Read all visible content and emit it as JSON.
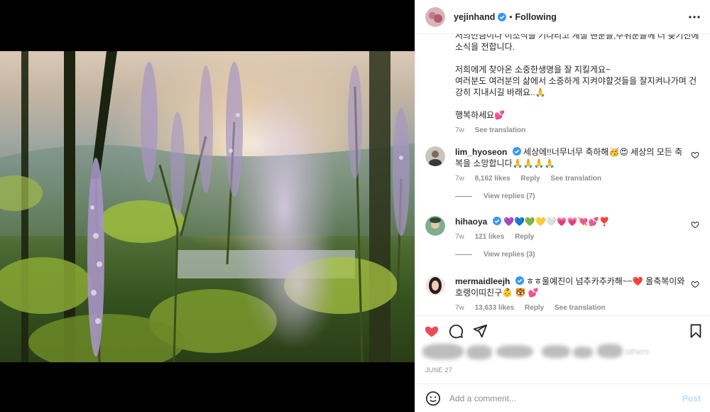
{
  "post": {
    "username": "yejinhand",
    "separator": "•",
    "follow_status": "Following",
    "more_icon": "more-horizontal-icon"
  },
  "caption": {
    "lines_1": "저의만큼이나 이소식을 기다리고 계실 팬분들,수위분들께 너 늦기전에 소식을 전합니다.",
    "lines_2": "저희에게 찾아온 소중한생명을 잘 지킬게요~\n여러분도 여러분의 삶에서 소중하게 지켜야할것들을 잘지켜나가며 건강히 지내시길 바래요..🙏",
    "lines_3": "행복하세요💕",
    "age": "7w",
    "see_translation": "See translation"
  },
  "comments": [
    {
      "username": "lim_hyoseon",
      "text": "세상에!!너무너무 축하해🥳😍 세상의 모든 축복을 소망합니다🙏🙏🙏🙏",
      "age": "7w",
      "likes": "8,162 likes",
      "reply": "Reply",
      "see_translation": "See translation",
      "view_replies": "View replies (7)"
    },
    {
      "username": "hihaoya",
      "text": "💜💙💚💛🤍💗💗💘💕❣️",
      "age": "7w",
      "likes": "121 likes",
      "reply": "Reply",
      "view_replies": "View replies (3)"
    },
    {
      "username": "mermaidleejh",
      "text": "ㅎㅎ울예진이 넘추카추카해~~❤️ 올축복이와 호랭이띠친구👶 🐯 💕",
      "age": "7w",
      "likes": "13,633 likes",
      "reply": "Reply",
      "see_translation": "See translation"
    }
  ],
  "liked_by_blurred": "others",
  "date": "JUNE 27",
  "add_comment": {
    "placeholder": "Add a comment...",
    "post_label": "Post"
  },
  "colors": {
    "like_red": "#ed4956",
    "verified_blue": "#3897f0",
    "text": "#262626",
    "muted": "#8e8e8e",
    "post_disabled": "#b2dffc"
  }
}
